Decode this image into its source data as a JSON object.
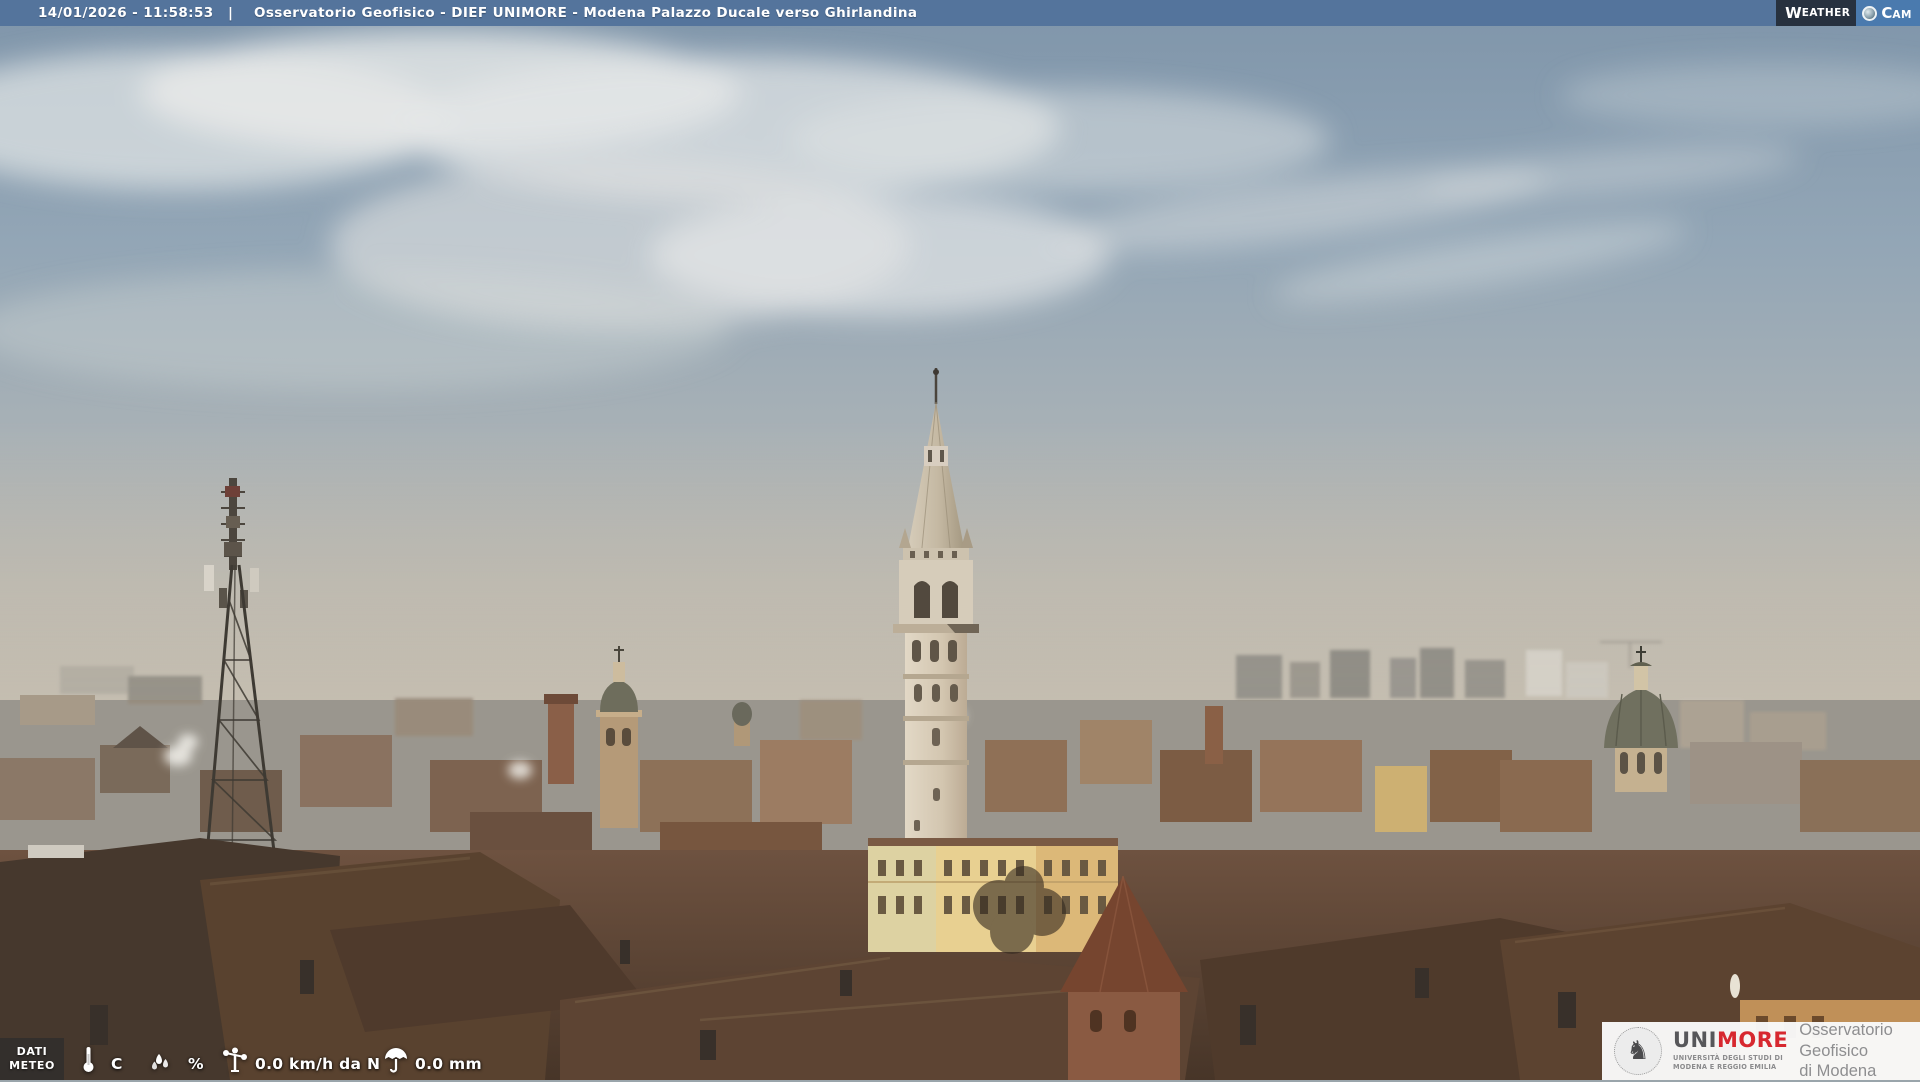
{
  "header": {
    "timestamp": "14/01/2026 - 11:58:53",
    "separator": "|",
    "title": "Osservatorio Geofisico - DIEF UNIMORE - Modena Palazzo Ducale verso Ghirlandina"
  },
  "weathercam": {
    "weather_initial": "W",
    "weather_rest": "EATHER",
    "cam_initial": "C",
    "cam_rest": "AM"
  },
  "weather_overlay": {
    "label_line1": "DATI",
    "label_line2": "METEO",
    "temperature": {
      "value": "",
      "unit": "C"
    },
    "humidity": {
      "value": "",
      "unit": "%"
    },
    "wind": {
      "value": "0.0 km/h da N"
    },
    "rain": {
      "value": "0.0 mm"
    }
  },
  "unimore": {
    "brand_uni": "UNI",
    "brand_more": "MORE",
    "subtitle_line1": "UNIVERSITÀ DEGLI STUDI DI",
    "subtitle_line2": "MODENA E REGGIO EMILIA",
    "org_line1": "Osservatorio Geofisico",
    "org_line2": "di Modena"
  },
  "colors": {
    "topbar": "#52739b",
    "weathercam_dark": "#27313f",
    "weathercam_blue": "#4a7aae",
    "unimore_red": "#d7282f",
    "unimore_gray": "#57575a"
  },
  "scene": {
    "city": "Modena",
    "landmarks": [
      "Ghirlandina tower",
      "Palazzo Ducale rooftops",
      "telecom lattice tower",
      "church dome",
      "hazy skyline high-rises"
    ]
  }
}
